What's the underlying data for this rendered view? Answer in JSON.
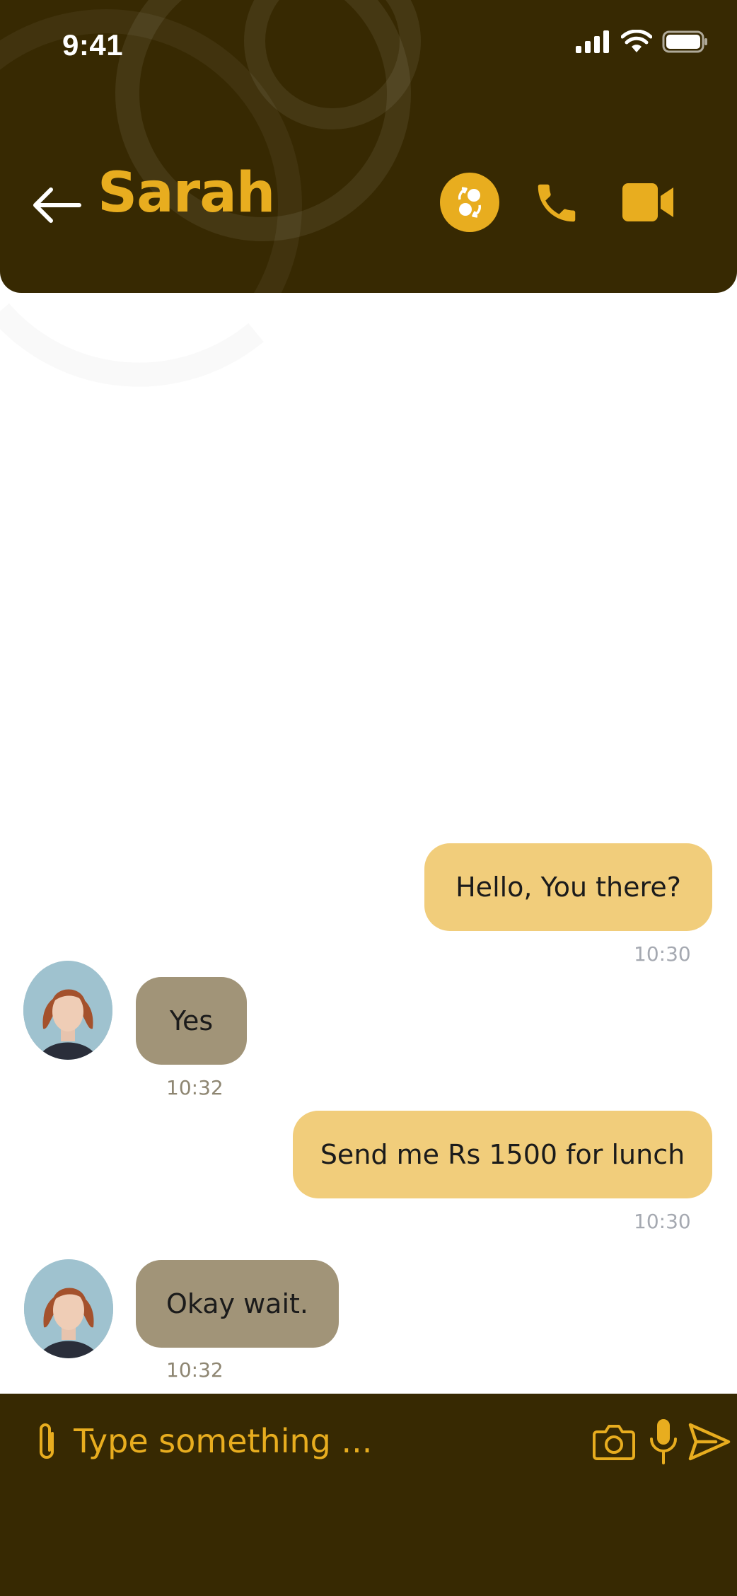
{
  "status_bar": {
    "time": "9:41",
    "icons": [
      "signal-icon",
      "wifi-icon",
      "battery-icon"
    ]
  },
  "header": {
    "title": "Sarah",
    "back_icon": "arrow-left-icon",
    "actions": [
      "swap-currency-icon",
      "phone-icon",
      "video-camera-icon"
    ]
  },
  "messages": [
    {
      "direction": "out",
      "text": "Hello, You there?",
      "time": "10:30"
    },
    {
      "direction": "in",
      "text": "Yes",
      "time": "10:32"
    },
    {
      "direction": "out",
      "text": "Send me Rs 1500 for lunch",
      "time": "10:30"
    },
    {
      "direction": "in",
      "text": "Okay wait.",
      "time": "10:32"
    }
  ],
  "composer": {
    "placeholder": "Type something ...",
    "value": "",
    "icons": [
      "paperclip-icon",
      "camera-icon",
      "microphone-icon",
      "send-icon"
    ]
  },
  "colors": {
    "header_bg": "#372902",
    "accent": "#e8ad1f",
    "outgoing_bubble": "#f1cd7b",
    "incoming_bubble": "#a19478",
    "timestamp_out": "#a5a9b1",
    "timestamp_in": "#8e8672"
  }
}
